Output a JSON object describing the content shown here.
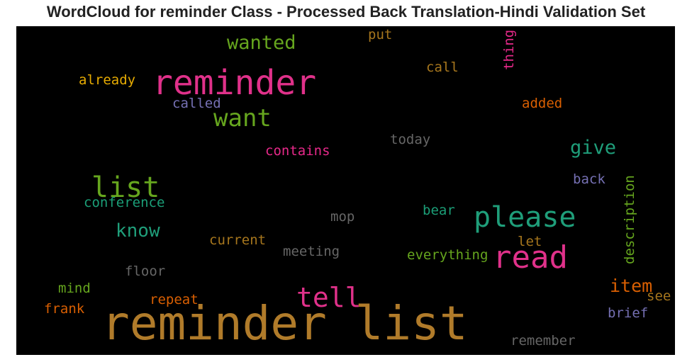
{
  "title": "WordCloud for reminder Class - Processed Back Translation-Hindi Validation Set",
  "words": {
    "reminder_list": {
      "text": "reminder list",
      "color": "#b07b2a"
    },
    "reminder": {
      "text": "reminder",
      "color": "#e0318a"
    },
    "please": {
      "text": "please",
      "color": "#1f9e7a"
    },
    "read": {
      "text": "read",
      "color": "#e0318a"
    },
    "list": {
      "text": "list",
      "color": "#66a61e"
    },
    "tell": {
      "text": "tell",
      "color": "#e0318a"
    },
    "want": {
      "text": "want",
      "color": "#66a61e"
    },
    "wanted": {
      "text": "wanted",
      "color": "#66a61e"
    },
    "give": {
      "text": "give",
      "color": "#1f9e7a"
    },
    "know": {
      "text": "know",
      "color": "#1f9e7a"
    },
    "item": {
      "text": "item",
      "color": "#d95f02"
    },
    "already": {
      "text": "already",
      "color": "#e6ab02"
    },
    "called": {
      "text": "called",
      "color": "#7570b3"
    },
    "put": {
      "text": "put",
      "color": "#a6761d"
    },
    "call": {
      "text": "call",
      "color": "#a6761d"
    },
    "thing": {
      "text": "thing",
      "color": "#e7298a"
    },
    "added": {
      "text": "added",
      "color": "#d95f02"
    },
    "today": {
      "text": "today",
      "color": "#666666"
    },
    "contains": {
      "text": "contains",
      "color": "#e7298a"
    },
    "back": {
      "text": "back",
      "color": "#7570b3"
    },
    "description": {
      "text": "description",
      "color": "#66a61e"
    },
    "conference": {
      "text": "conference",
      "color": "#1b9e77"
    },
    "mop": {
      "text": "mop",
      "color": "#666666"
    },
    "bear": {
      "text": "bear",
      "color": "#1b9e77"
    },
    "current": {
      "text": "current",
      "color": "#a6761d"
    },
    "let": {
      "text": "let",
      "color": "#a6761d"
    },
    "meeting": {
      "text": "meeting",
      "color": "#666666"
    },
    "everything": {
      "text": "everything",
      "color": "#66a61e"
    },
    "floor": {
      "text": "floor",
      "color": "#666666"
    },
    "mind": {
      "text": "mind",
      "color": "#66a61e"
    },
    "repeat": {
      "text": "repeat",
      "color": "#d95f02"
    },
    "see": {
      "text": "see",
      "color": "#a6761d"
    },
    "frank": {
      "text": "frank",
      "color": "#d95f02"
    },
    "brief": {
      "text": "brief",
      "color": "#7570b3"
    },
    "remember": {
      "text": "remember",
      "color": "#666666"
    }
  }
}
